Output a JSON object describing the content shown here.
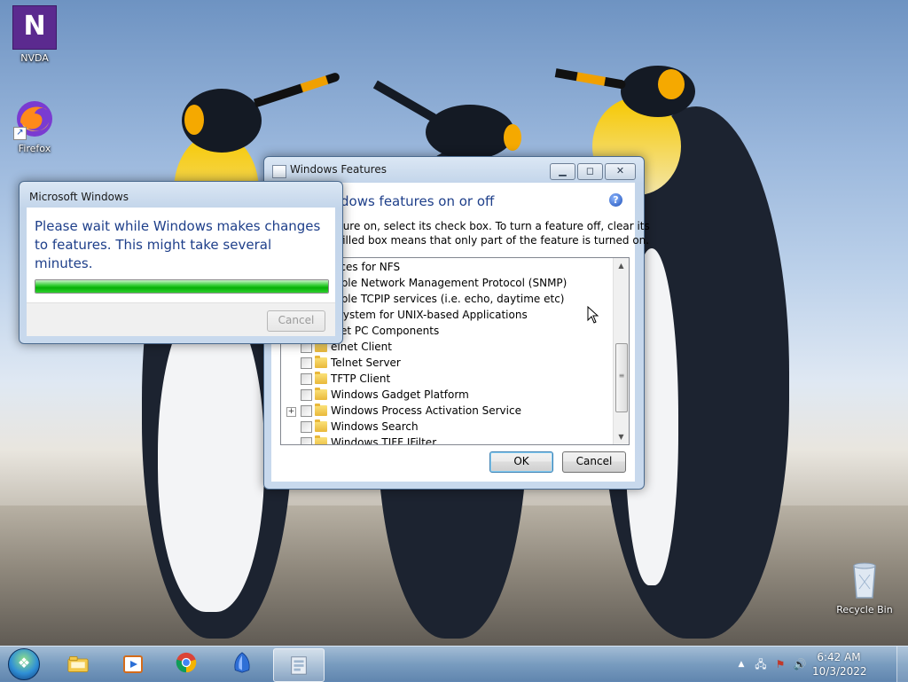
{
  "desktop": {
    "icons": [
      {
        "label": "NVDA"
      },
      {
        "label": "Firefox"
      },
      {
        "label": "Recycle Bin"
      }
    ]
  },
  "features_window": {
    "title": "Windows Features",
    "heading": "dows features on or off",
    "description_line1": "ture on, select its check box. To turn a feature off, clear its",
    "description_line2": "filled box means that only part of the feature is turned on.",
    "items": [
      {
        "label": "vices for NFS"
      },
      {
        "label": "mple Network Management Protocol (SNMP)"
      },
      {
        "label": "mple TCPIP services (i.e. echo, daytime etc)"
      },
      {
        "label": "bsystem for UNIX-based Applications"
      },
      {
        "label": "blet PC Components"
      },
      {
        "label": "elnet Client"
      },
      {
        "label": "Telnet Server"
      },
      {
        "label": "TFTP Client"
      },
      {
        "label": "Windows Gadget Platform"
      },
      {
        "label": "Windows Process Activation Service",
        "expandable": true
      },
      {
        "label": "Windows Search"
      },
      {
        "label": "Windows TIFF IFilter"
      }
    ],
    "ok_label": "OK",
    "cancel_label": "Cancel",
    "help_glyph": "?"
  },
  "progress_dialog": {
    "title": "Microsoft Windows",
    "message": "Please wait while Windows makes changes to features. This might take several minutes.",
    "progress_fraction": 1.0,
    "cancel_label": "Cancel"
  },
  "taskbar": {
    "pinned": [
      {
        "icon": "explorer-folder-icon"
      },
      {
        "icon": "media-player-icon"
      },
      {
        "icon": "chrome-icon"
      },
      {
        "icon": "nvda-icon"
      },
      {
        "icon": "windows-features-icon",
        "active": true
      }
    ],
    "time": "6:42 AM",
    "date": "10/3/2022"
  },
  "colors": {
    "progress_green": "#06b006",
    "title_blue": "#1e3f8a",
    "nvda_purple": "#5b2a8f"
  }
}
